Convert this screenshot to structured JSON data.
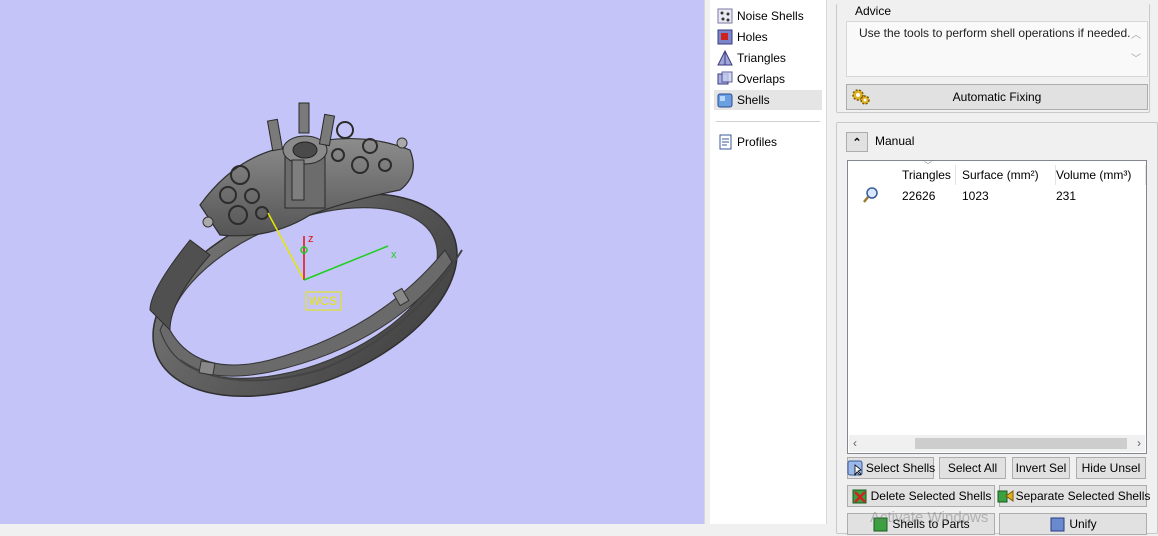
{
  "viewport": {
    "axis_labels": {
      "x": "x",
      "z": "z"
    },
    "wcs_label": "WCS",
    "background_color": "#c4c4f8",
    "axis_colors": {
      "x": "#1ecf1e",
      "y": "#e8e800",
      "z": "#e01010"
    }
  },
  "tree": {
    "items": [
      {
        "label": "Noise Shells",
        "icon": "noise-shells-icon"
      },
      {
        "label": "Holes",
        "icon": "holes-icon"
      },
      {
        "label": "Triangles",
        "icon": "triangles-icon"
      },
      {
        "label": "Overlaps",
        "icon": "overlaps-icon"
      },
      {
        "label": "Shells",
        "icon": "shells-icon",
        "selected": true
      },
      {
        "label": "Profiles",
        "icon": "profiles-icon"
      }
    ]
  },
  "advice": {
    "title": "Advice",
    "text": "Use the tools to perform shell operations if needed.",
    "auto_fix_label": "Automatic Fixing"
  },
  "manual": {
    "label": "Manual",
    "columns": [
      "Triangles",
      "Surface (mm²)",
      "Volume (mm³)"
    ],
    "rows": [
      {
        "triangles": "22626",
        "surface": "1023",
        "volume": "231"
      }
    ]
  },
  "buttons": {
    "select_shells": "Select Shells",
    "select_all": "Select All",
    "invert_sel": "Invert Sel",
    "hide_unsel": "Hide Unsel",
    "delete_selected": "Delete Selected Shells",
    "separate_selected": "Separate Selected Shells",
    "shells_to_parts": "Shells to Parts",
    "unify": "Unify"
  },
  "watermark": "Activate Windows"
}
